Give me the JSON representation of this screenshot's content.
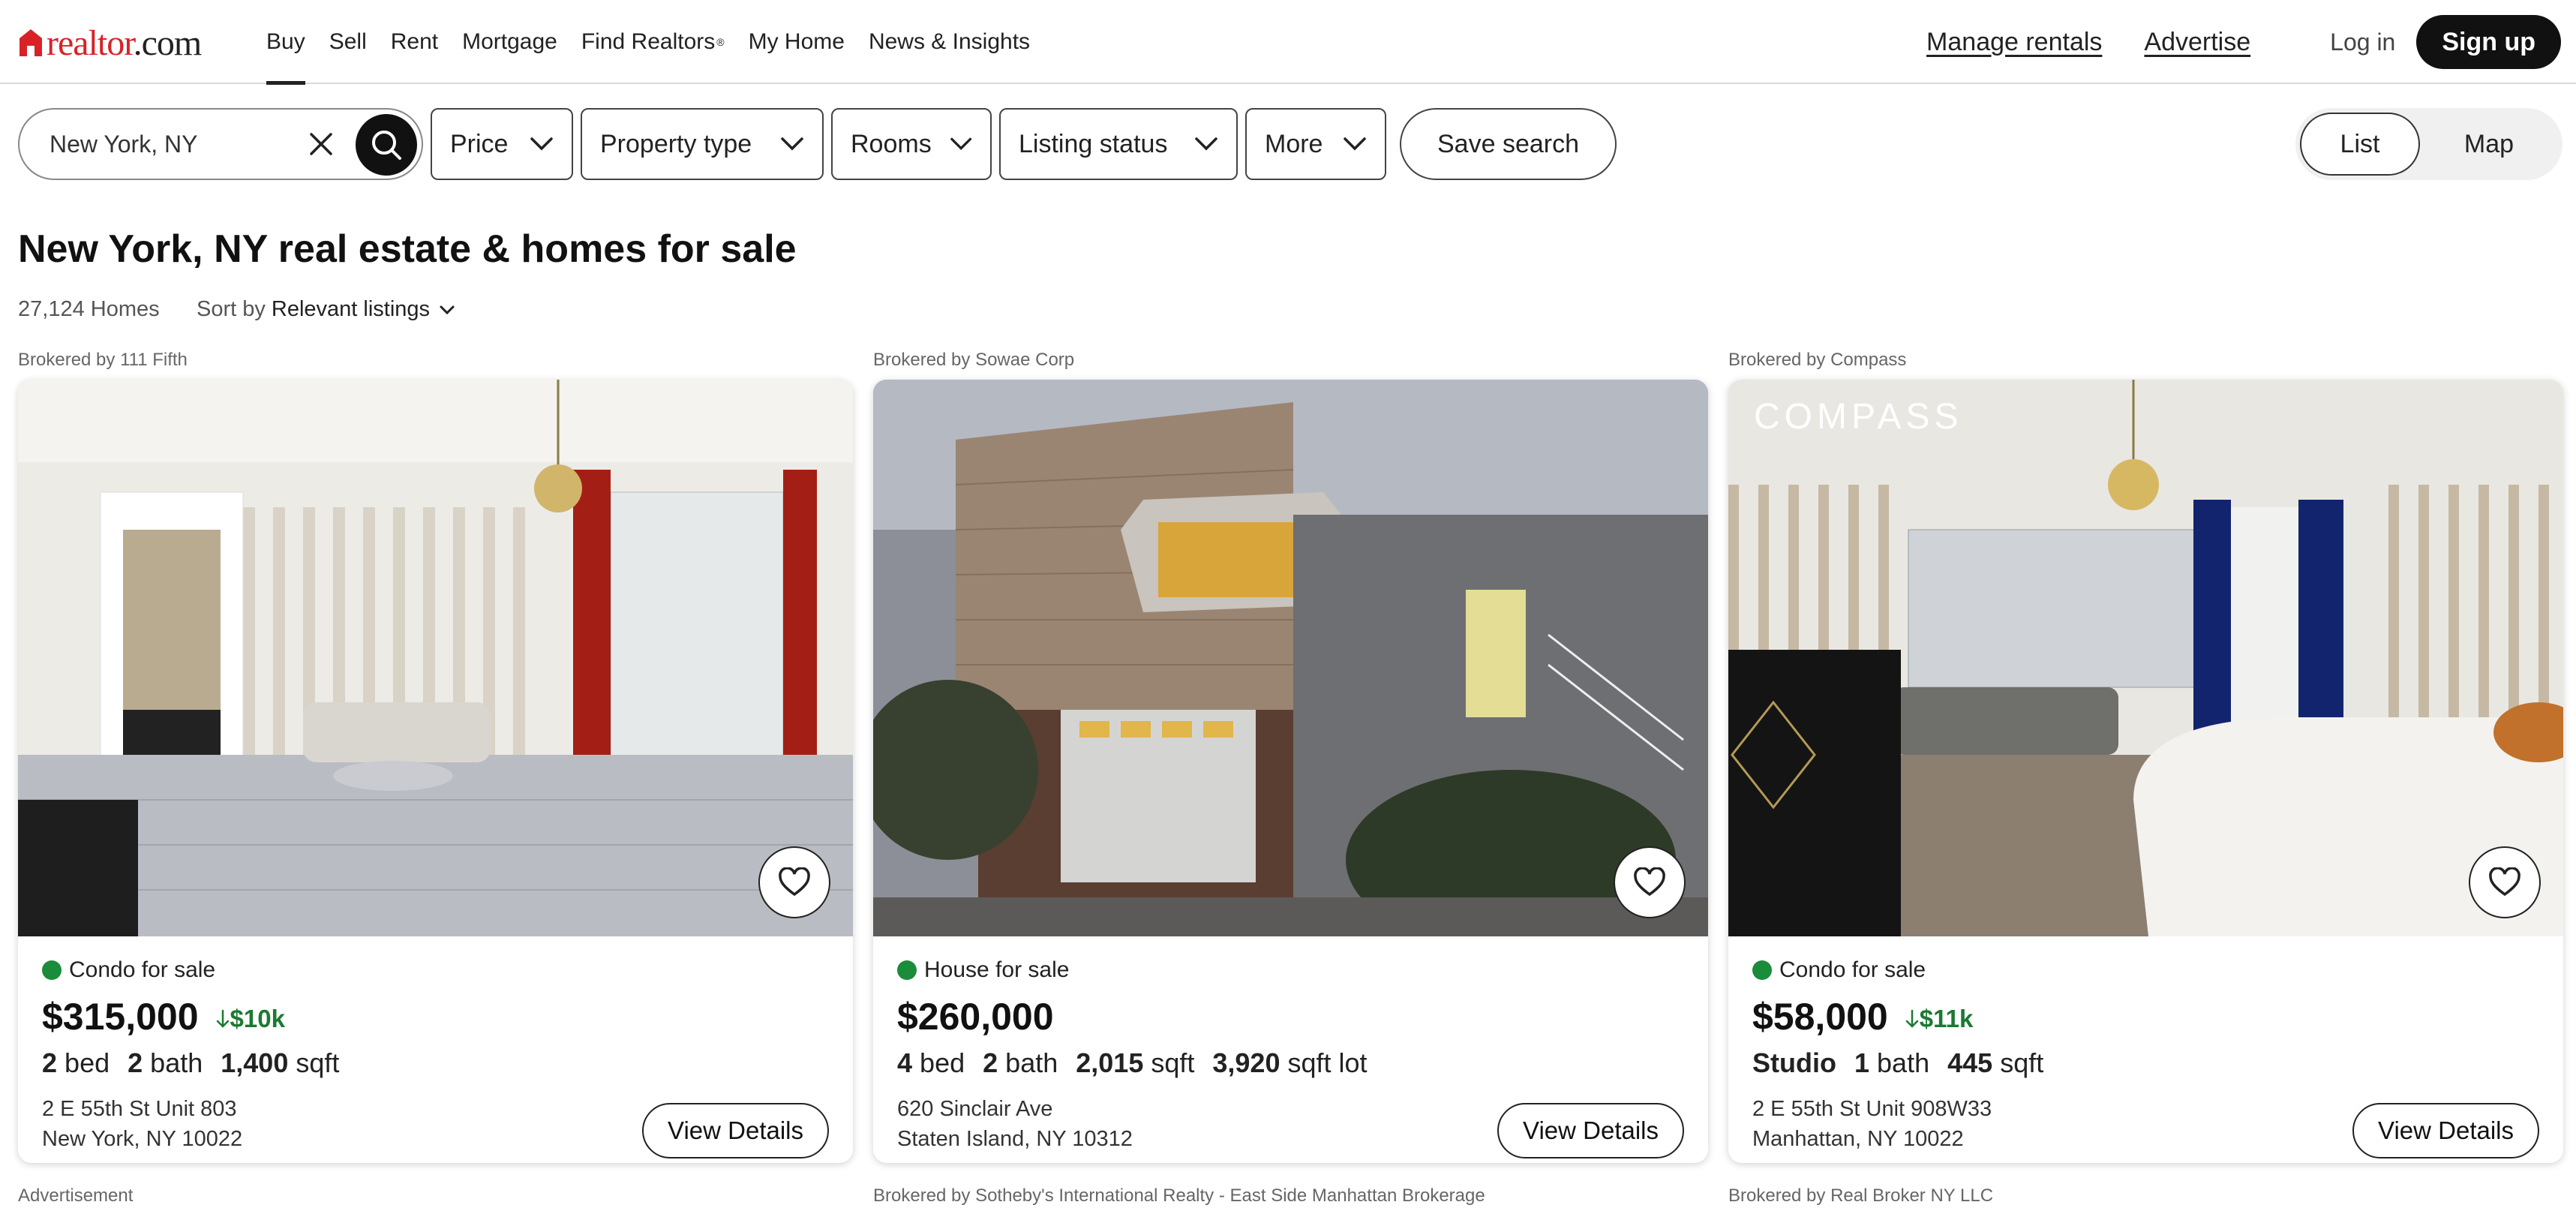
{
  "header": {
    "logo_text": "realtor",
    "logo_suffix": ".com",
    "nav": [
      "Buy",
      "Sell",
      "Rent",
      "Mortgage",
      "Find Realtors",
      "My Home",
      "News & Insights"
    ],
    "nav_find_realtors_mark": "®",
    "manage_rentals": "Manage rentals",
    "advertise": "Advertise",
    "login": "Log in",
    "signup": "Sign up"
  },
  "filters": {
    "search_value": "New York, NY",
    "price": "Price",
    "property_type": "Property type",
    "rooms": "Rooms",
    "listing_status": "Listing status",
    "more": "More",
    "save_search": "Save search",
    "view_list": "List",
    "view_map": "Map"
  },
  "results": {
    "title": "New York, NY real estate & homes for sale",
    "count": "27,124 Homes",
    "sort_label": "Sort by",
    "sort_value": "Relevant listings"
  },
  "listings": [
    {
      "brokered": "Brokered by 111 Fifth",
      "status": "Condo for sale",
      "price": "$315,000",
      "price_drop": "$10k",
      "beds_num": "2",
      "beds_label": "bed",
      "baths_num": "2",
      "baths_label": "bath",
      "sqft_num": "1,400",
      "sqft_label": "sqft",
      "address_line1": "2 E 55th St Unit 803",
      "address_line2": "New York, NY 10022",
      "view_details": "View Details"
    },
    {
      "brokered": "Brokered by Sowae Corp",
      "status": "House for sale",
      "price": "$260,000",
      "beds_num": "4",
      "beds_label": "bed",
      "baths_num": "2",
      "baths_label": "bath",
      "sqft_num": "2,015",
      "sqft_label": "sqft",
      "lot_num": "3,920",
      "lot_label": "sqft lot",
      "address_line1": "620 Sinclair Ave",
      "address_line2": "Staten Island, NY 10312",
      "view_details": "View Details"
    },
    {
      "brokered": "Brokered by Compass",
      "photo_watermark": "COMPASS",
      "status": "Condo for sale",
      "price": "$58,000",
      "price_drop": "$11k",
      "studio": "Studio",
      "baths_num": "1",
      "baths_label": "bath",
      "sqft_num": "445",
      "sqft_label": "sqft",
      "address_line1": "2 E 55th St Unit 908W33",
      "address_line2": "Manhattan, NY 10022",
      "view_details": "View Details"
    }
  ],
  "next_row": {
    "col1": "Advertisement",
    "col2": "Brokered by Sotheby's International Realty - East Side Manhattan Brokerage",
    "col3": "Brokered by Real Broker NY LLC"
  },
  "colors": {
    "brand_red": "#d92228",
    "status_green": "#1a8c3a",
    "price_drop_green": "#1b7a30",
    "dark": "#111111"
  }
}
